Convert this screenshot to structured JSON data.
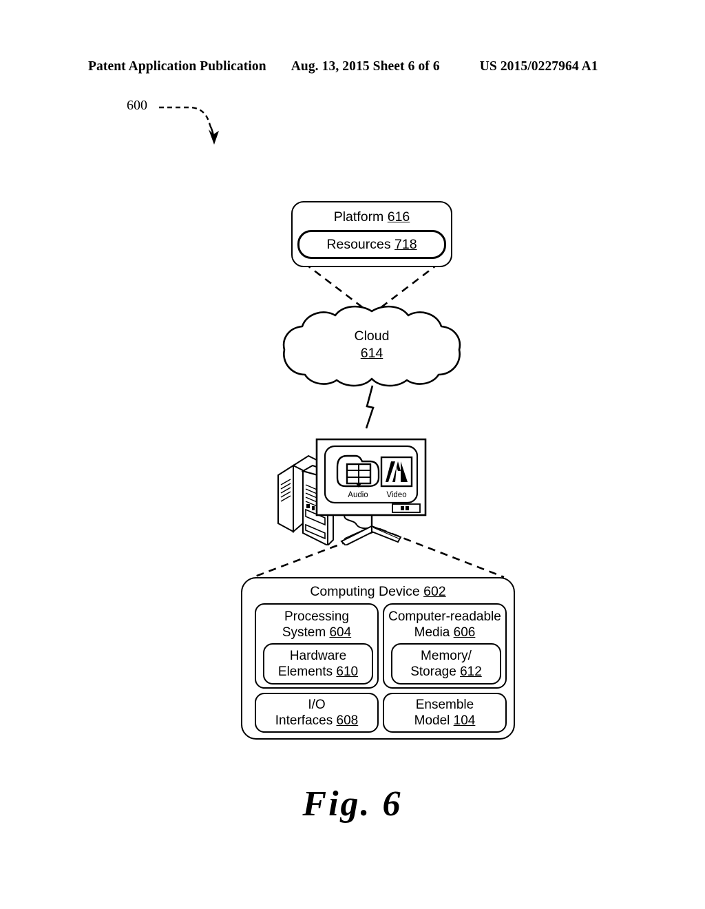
{
  "header": {
    "publication": "Patent Application Publication",
    "date_sheet": "Aug. 13, 2015  Sheet 6 of 6",
    "patent_number": "US 2015/0227964 A1"
  },
  "figure": {
    "reference_number": "600",
    "caption": "Fig. 6"
  },
  "platform": {
    "title": "Platform",
    "title_ref": "616",
    "resources_label": "Resources",
    "resources_ref": "718"
  },
  "cloud": {
    "label": "Cloud",
    "ref": "614"
  },
  "computer": {
    "audio_label": "Audio",
    "video_label": "Video"
  },
  "computing_device": {
    "title": "Computing Device",
    "title_ref": "602",
    "cells": [
      {
        "title_line1": "Processing",
        "title_line2": "System",
        "title_ref": "604",
        "inner_line1": "Hardware",
        "inner_line2": "Elements",
        "inner_ref": "610"
      },
      {
        "title_line1": "Computer-readable",
        "title_line2": "Media",
        "title_ref": "606",
        "inner_line1": "Memory/",
        "inner_line2": "Storage",
        "inner_ref": "612"
      }
    ],
    "io": {
      "line1": "I/O",
      "line2": "Interfaces",
      "ref": "608"
    },
    "ensemble": {
      "line1": "Ensemble",
      "line2": "Model",
      "ref": "104"
    }
  },
  "colors": {
    "ink": "#000000",
    "paper": "#ffffff"
  }
}
